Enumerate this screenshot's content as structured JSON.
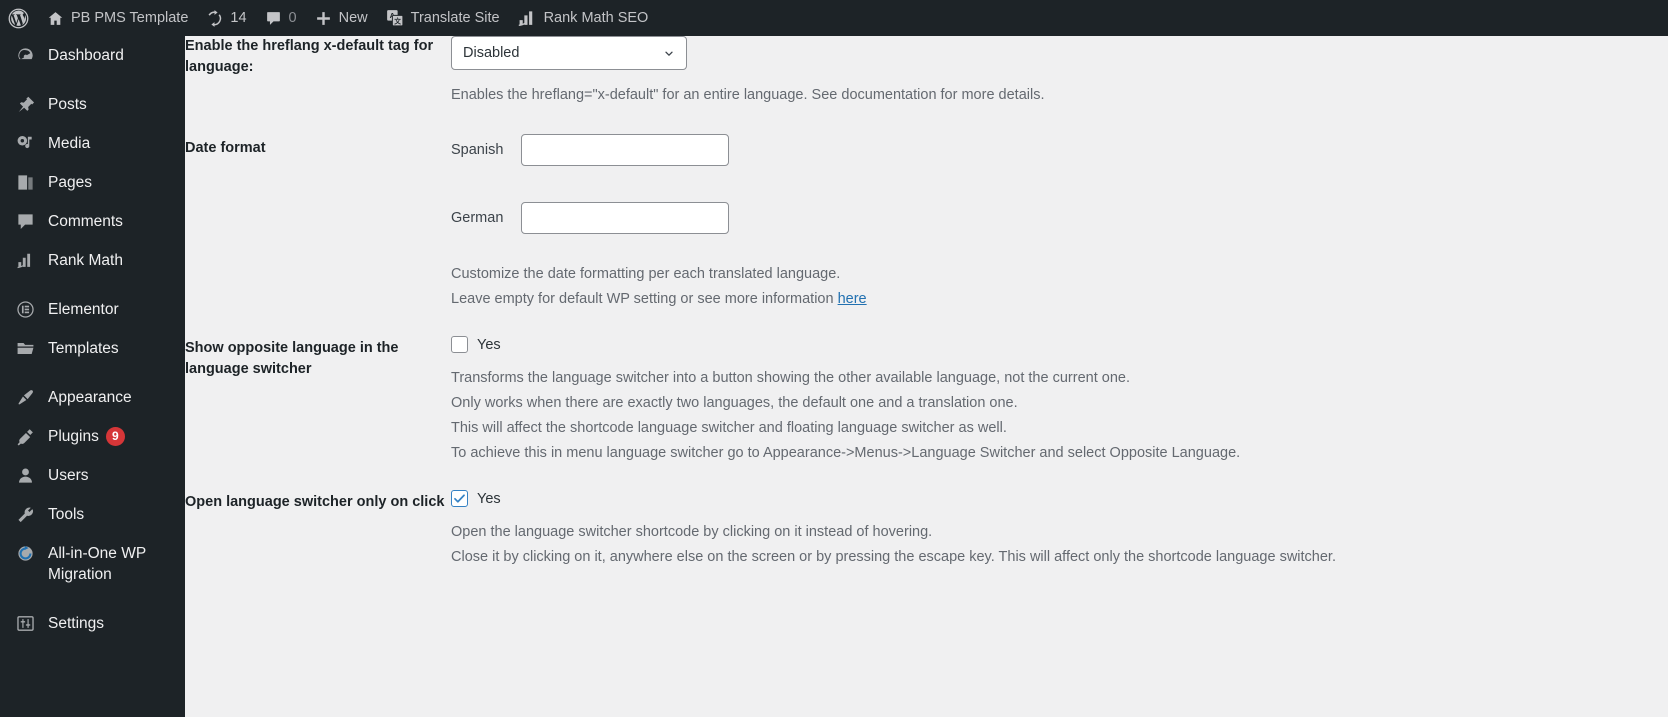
{
  "adminbar": {
    "items": [
      {
        "icon": "wordpress-logo-icon",
        "label": ""
      },
      {
        "icon": "home-icon",
        "label": "PB PMS Template"
      },
      {
        "icon": "updates-icon",
        "label": "14"
      },
      {
        "icon": "comment-bubble-icon",
        "label": "0"
      },
      {
        "icon": "plus-icon",
        "label": "New"
      },
      {
        "icon": "translate-icon",
        "label": "Translate Site"
      },
      {
        "icon": "rank-math-icon",
        "label": "Rank Math SEO"
      }
    ]
  },
  "sidebar": {
    "items": [
      {
        "icon": "dashboard-icon",
        "label": "Dashboard",
        "badge": "",
        "separator_after": true
      },
      {
        "icon": "pin-icon",
        "label": "Posts",
        "badge": "",
        "separator_after": false
      },
      {
        "icon": "media-icon",
        "label": "Media",
        "badge": "",
        "separator_after": false
      },
      {
        "icon": "pages-icon",
        "label": "Pages",
        "badge": "",
        "separator_after": false
      },
      {
        "icon": "comments-icon",
        "label": "Comments",
        "badge": "",
        "separator_after": false
      },
      {
        "icon": "rank-math-icon",
        "label": "Rank Math",
        "badge": "",
        "separator_after": true
      },
      {
        "icon": "elementor-icon",
        "label": "Elementor",
        "badge": "",
        "separator_after": false
      },
      {
        "icon": "templates-folder-icon",
        "label": "Templates",
        "badge": "",
        "separator_after": true
      },
      {
        "icon": "appearance-brush-icon",
        "label": "Appearance",
        "badge": "",
        "separator_after": false
      },
      {
        "icon": "plugins-plug-icon",
        "label": "Plugins",
        "badge": "9",
        "separator_after": false
      },
      {
        "icon": "users-icon",
        "label": "Users",
        "badge": "",
        "separator_after": false
      },
      {
        "icon": "tools-wrench-icon",
        "label": "Tools",
        "badge": "",
        "separator_after": false
      },
      {
        "icon": "all-in-one-wp-migration-icon",
        "label": "All-in-One WP Migration",
        "badge": "",
        "separator_after": true
      },
      {
        "icon": "settings-sliders-icon",
        "label": "Settings",
        "badge": "",
        "separator_after": false
      }
    ]
  },
  "settings": {
    "hreflang": {
      "label": "Enable the hreflang x-default tag for language:",
      "select_value": "Disabled",
      "options": [
        "Disabled"
      ],
      "description": "Enables the hreflang=\"x-default\" for an entire language. See documentation for more details."
    },
    "date_format": {
      "label": "Date format",
      "fields": [
        {
          "label": "Spanish",
          "value": "",
          "placeholder": ""
        },
        {
          "label": "German",
          "value": "",
          "placeholder": ""
        }
      ],
      "description_line1": "Customize the date formatting per each translated language.",
      "description_line2_prefix": "Leave empty for default WP setting or see more information ",
      "description_link": "here"
    },
    "opposite_language": {
      "label": "Show opposite language in the language switcher",
      "checkbox_label": "Yes",
      "checked": false,
      "descriptions": [
        "Transforms the language switcher into a button showing the other available language, not the current one.",
        "Only works when there are exactly two languages, the default one and a translation one.",
        "This will affect the shortcode language switcher and floating language switcher as well.",
        "To achieve this in menu language switcher go to Appearance->Menus->Language Switcher and select Opposite Language."
      ]
    },
    "open_on_click": {
      "label": "Open language switcher only on click",
      "checkbox_label": "Yes",
      "checked": true,
      "descriptions": [
        "Open the language switcher shortcode by clicking on it instead of hovering.",
        "Close it by clicking on it, anywhere else on the screen or by pressing the escape key. This will affect only the shortcode language switcher."
      ]
    }
  },
  "colors": {
    "admin_dark": "#1d2327",
    "content_bg": "#f0f0f1",
    "badge_red": "#d63638",
    "link_blue": "#2271b1",
    "checkbox_blue": "#3582c4"
  }
}
